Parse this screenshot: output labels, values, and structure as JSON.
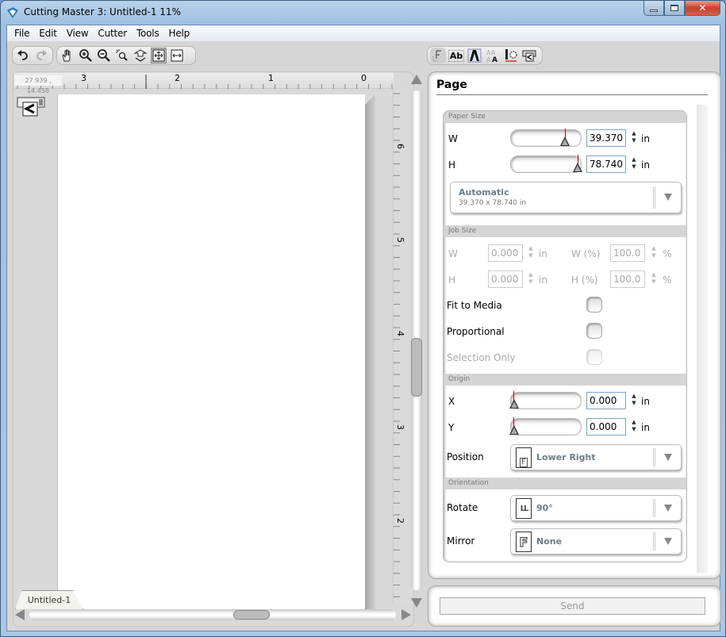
{
  "window": {
    "title": "Cutting Master 3: Untitled-1 11%",
    "controls": [
      "minimize",
      "maximize",
      "close"
    ]
  },
  "menubar": {
    "items": [
      "File",
      "Edit",
      "View",
      "Cutter",
      "Tools",
      "Help"
    ]
  },
  "toolbar_left": {
    "history": [
      {
        "name": "undo-icon",
        "enabled": true
      },
      {
        "name": "redo-icon",
        "enabled": false
      }
    ],
    "view_tools": [
      {
        "name": "hand-pan-icon"
      },
      {
        "name": "zoom-in-icon"
      },
      {
        "name": "zoom-out-icon"
      },
      {
        "name": "zoom-selection-icon"
      },
      {
        "name": "zoom-to-page-icon"
      },
      {
        "name": "fit-all-icon"
      },
      {
        "name": "fit-width-icon"
      }
    ]
  },
  "toolbar_right": {
    "tools": [
      {
        "name": "page-setup-icon",
        "active": true
      },
      {
        "name": "text-icon",
        "glyph": "Ab"
      },
      {
        "name": "font-outline-icon"
      },
      {
        "name": "font-size-icon"
      },
      {
        "name": "cutter-settings-icon"
      },
      {
        "name": "cutter-icon"
      }
    ]
  },
  "canvas": {
    "coordinates": "27.939 , 14.458",
    "hruler_labels": [
      "3",
      "2",
      "1",
      "0"
    ],
    "vruler_labels": [
      "6",
      "5",
      "4",
      "3",
      "2"
    ],
    "document_tab": "Untitled-1"
  },
  "panel": {
    "title": "Page",
    "paper_size": {
      "section_label": "Paper Size",
      "w_label": "W",
      "w_value": "39.370",
      "h_label": "H",
      "h_value": "78.740",
      "unit": "in",
      "w_slider_fraction": 0.75,
      "h_slider_fraction": 0.98,
      "preset": "Automatic",
      "preset_detail": "39.370 x 78.740 in"
    },
    "job_size": {
      "section_label": "Job Size",
      "w_label": "W",
      "w_value": "0.000",
      "h_label": "H",
      "h_value": "0.000",
      "unit": "in",
      "wpct_label": "W (%)",
      "wpct_value": "100.0",
      "hpct_label": "H (%)",
      "hpct_value": "100.0",
      "pct_unit": "%",
      "fit_to_media": "Fit to Media",
      "proportional": "Proportional",
      "selection_only": "Selection Only"
    },
    "origin": {
      "section_label": "Origin",
      "x_label": "X",
      "x_value": "0.000",
      "y_label": "Y",
      "y_value": "0.000",
      "unit": "in",
      "position_label": "Position",
      "position_value": "Lower Right"
    },
    "orientation": {
      "section_label": "Orientation",
      "rotate_label": "Rotate",
      "rotate_value": "90°",
      "mirror_label": "Mirror",
      "mirror_value": "None"
    }
  },
  "send": {
    "label": "Send"
  }
}
